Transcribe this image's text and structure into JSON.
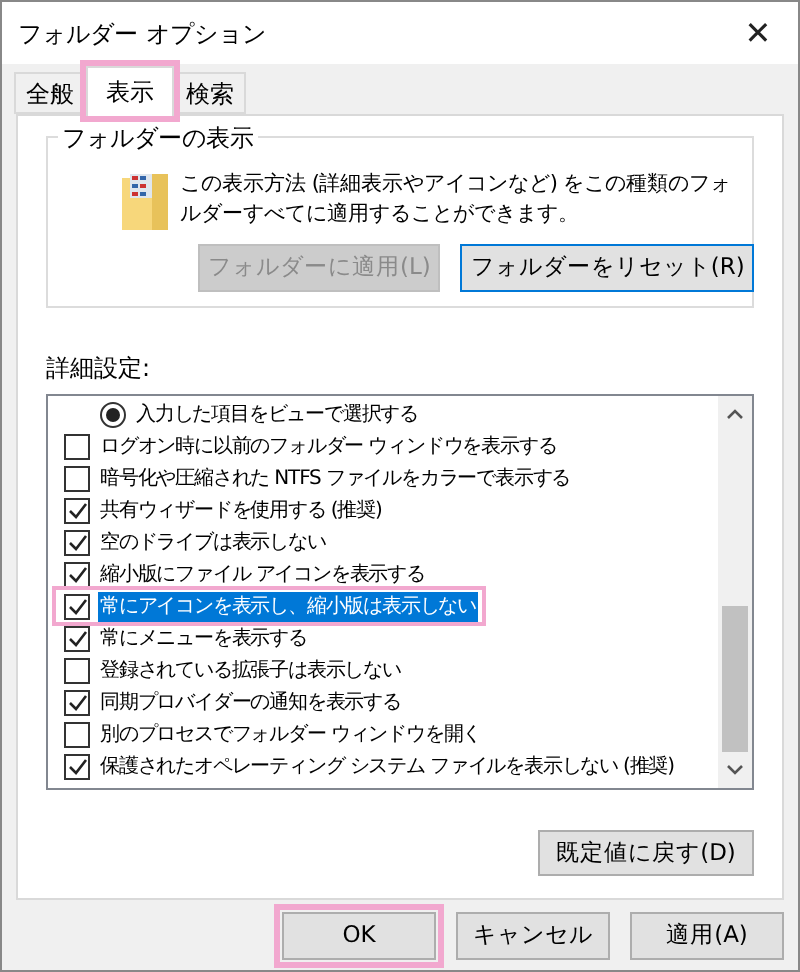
{
  "window": {
    "title": "フォルダー オプション",
    "close": "✕"
  },
  "tabs": [
    {
      "label": "全般",
      "selected": false,
      "highlighted": false
    },
    {
      "label": "表示",
      "selected": true,
      "highlighted": true
    },
    {
      "label": "検索",
      "selected": false,
      "highlighted": false
    }
  ],
  "folder_views": {
    "title": "フォルダーの表示",
    "description": "この表示方法 (詳細表示やアイコンなど) をこの種類のフォルダーすべてに適用することができます。",
    "buttons": [
      {
        "label": "フォルダーに適用(L)",
        "disabled": true
      },
      {
        "label": "フォルダーをリセット(R)",
        "disabled": false
      }
    ]
  },
  "advanced": {
    "title": "詳細設定:",
    "items": [
      {
        "kind": "radio",
        "label": "入力した項目をビューで選択する",
        "checked": true,
        "selected": false,
        "highlighted": false
      },
      {
        "kind": "checkbox",
        "label": "ログオン時に以前のフォルダー ウィンドウを表示する",
        "checked": false,
        "selected": false,
        "highlighted": false
      },
      {
        "kind": "checkbox",
        "label": "暗号化や圧縮された NTFS ファイルをカラーで表示する",
        "checked": false,
        "selected": false,
        "highlighted": false
      },
      {
        "kind": "checkbox",
        "label": "共有ウィザードを使用する (推奨)",
        "checked": true,
        "selected": false,
        "highlighted": false
      },
      {
        "kind": "checkbox",
        "label": "空のドライブは表示しない",
        "checked": true,
        "selected": false,
        "highlighted": false
      },
      {
        "kind": "checkbox",
        "label": "縮小版にファイル アイコンを表示する",
        "checked": true,
        "selected": false,
        "highlighted": false
      },
      {
        "kind": "checkbox",
        "label": "常にアイコンを表示し、縮小版は表示しない",
        "checked": true,
        "selected": true,
        "highlighted": true
      },
      {
        "kind": "checkbox",
        "label": "常にメニューを表示する",
        "checked": true,
        "selected": false,
        "highlighted": false
      },
      {
        "kind": "checkbox",
        "label": "登録されている拡張子は表示しない",
        "checked": false,
        "selected": false,
        "highlighted": false
      },
      {
        "kind": "checkbox",
        "label": "同期プロバイダーの通知を表示する",
        "checked": true,
        "selected": false,
        "highlighted": false
      },
      {
        "kind": "checkbox",
        "label": "別のプロセスでフォルダー ウィンドウを開く",
        "checked": false,
        "selected": false,
        "highlighted": false
      },
      {
        "kind": "checkbox",
        "label": "保護されたオペレーティング システム ファイルを表示しない (推奨)",
        "checked": true,
        "selected": false,
        "highlighted": false
      }
    ],
    "restore_button": "既定値に戻す(D)"
  },
  "buttons": [
    {
      "label": "OK",
      "highlighted": true
    },
    {
      "label": "キャンセル",
      "highlighted": false
    },
    {
      "label": "適用(A)",
      "highlighted": false
    }
  ]
}
